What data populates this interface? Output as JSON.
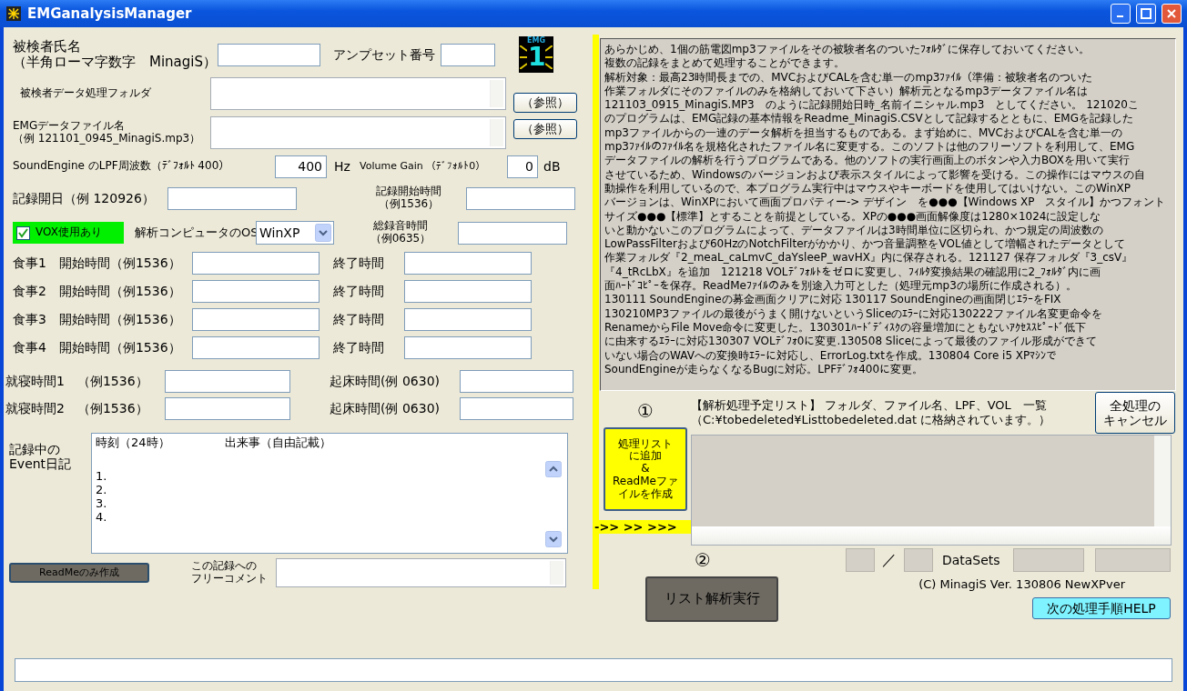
{
  "window": {
    "title": "EMGanalysisManager"
  },
  "logo": {
    "caption": "EMG",
    "digit": "1"
  },
  "subject_name": {
    "label": [
      "被検者氏名",
      "（半角ローマ字数字　MinagiS）"
    ]
  },
  "amp_set": {
    "label": "アンプセット番号"
  },
  "folder": {
    "label": "被検者データ処理フォルダ",
    "button": "（参照）"
  },
  "emg_file": {
    "label": [
      "EMGデータファイル名",
      "（例 121101_0945_MinagiS.mp3）"
    ],
    "button": "（参照）"
  },
  "lpf": {
    "label": "SoundEngine のLPF周波数（ﾃﾞﾌｫﾙﾄ 400）",
    "value": "400",
    "unit": "Hz"
  },
  "volume_gain": {
    "label": "Volume Gain （ﾃﾞﾌｫﾙﾄ0）",
    "value": "0",
    "unit": "dB"
  },
  "record_date": {
    "label": "記録開日（例 120926）"
  },
  "record_start": {
    "label": [
      "記録開始時間",
      "（例1536）"
    ]
  },
  "vox": {
    "label": "VOX使用あり",
    "checked": true
  },
  "os": {
    "label": "解析コンピュータのOS",
    "value": "WinXP"
  },
  "total_time": {
    "label": [
      "総録音時間",
      "（例0635）"
    ]
  },
  "meals": [
    {
      "label": "食事1　開始時間（例1536）",
      "end_label": "終了時間"
    },
    {
      "label": "食事2　開始時間（例1536）",
      "end_label": "終了時間"
    },
    {
      "label": "食事3　開始時間（例1536）",
      "end_label": "終了時間"
    },
    {
      "label": "食事4　開始時間（例1536）",
      "end_label": "終了時間"
    }
  ],
  "sleep": [
    {
      "label": "就寝時間1　（例1536）",
      "wake_label": "起床時間(例 0630)"
    },
    {
      "label": "就寝時間2　（例1536）",
      "wake_label": "起床時間(例 0630)"
    }
  ],
  "diary": {
    "label": [
      "記録中の",
      "Event日記"
    ],
    "header": [
      "時刻（24時）",
      "出来事（自由記載）"
    ],
    "lines": [
      "1.",
      "2.",
      "3.",
      "4."
    ]
  },
  "readme_button": "ReadMeのみ作成",
  "comment": {
    "label": [
      "この記録への",
      "フリーコメント"
    ]
  },
  "info_lines": [
    "あらかじめ、1個の筋電図mp3ファイルをその被験者名のついたﾌｫﾙﾀﾞに保存しておいてください。",
    "複数の記録をまとめて処理することができます。",
    "解析対象：最高23時間長までの、MVCおよびCALを含む単一のmp3ﾌｧｲﾙ（準備：被験者名のついた",
    "作業フォルダにそのファイルのみを格納しておいて下さい）解析元となるmp3データファイル名は",
    "121103_0915_MinagiS.MP3　のように記録開始日時_名前イニシャル.mp3　としてください。 121020こ",
    "のプログラムは、EMG記録の基本情報をReadme_MinagiS.CSVとして記録するとともに、EMGを記録した",
    "mp3ファイルからの一連のデータ解析を担当するものである。まず始めに、MVCおよびCALを含む単一の",
    "mp3ﾌｧｲﾙのﾌｧｲﾙ名を規格化されたファイル名に変更する。このソフトは他のフリーソフトを利用して、EMG",
    "データファイルの解析を行うプログラムである。他のソフトの実行画面上のボタンや入力BOXを用いて実行",
    "させているため、Windowsのバージョンおよび表示スタイルによって影響を受ける。この操作にはマウスの自",
    "動操作を利用しているので、本プログラム実行中はマウスやキーボードを使用してはいけない。このWinXP",
    "バージョンは、WinXPにおいて画面プロパティー-> デザイン　を●●●【Windows XP　スタイル】かつフォント",
    "サイズ●●●【標準】とすることを前提としている。XPの●●●画面解像度は1280×1024に設定しな",
    "いと動かないこのプログラムによって、データファイルは3時間単位に区切られ、かつ規定の周波数の",
    "LowPassFilterおよび60HzのNotchFilterがかかり、かつ音量調整をVOL値として増幅されたデータとして",
    "作業フォルダ『2_meaL_caLmvC_daYsleeP_wavHX』内に保存される。121127 保存フォルダ『3_csV』",
    "『4_tRcLbX』を追加　121218 VOLﾃﾞﾌｫﾙﾄをゼロに変更し、ﾌｨﾙﾀ変換結果の確認用に2_ﾌｫﾙﾀﾞ内に画",
    "面ﾊｰﾄﾞｺﾋﾟｰを保存。ReadMeﾌｧｲﾙのみを別途入力可とした（処理元mp3の場所に作成される）。",
    "130111 SoundEngineの募金画面クリアに対応 130117 SoundEngineの画面閉じｴﾗｰをFIX",
    "130210MP3ファイルの最後がうまく開けないというSliceのｴﾗｰに対応130222ファイル名変更命令を",
    "RenameからFile Move命令に変更した。130301ﾊｰﾄﾞﾃﾞｨｽｸの容量増加にともないｱｸｾｽｽﾋﾟｰﾄﾞ低下",
    "に由来するｴﾗｰに対応130307 VOLﾃﾞﾌｫ0に変更.130508 Sliceによって最後のファイル形成ができて",
    "いない場合のWAVへの変換時ｴﾗｰに対応し、ErrorLog.txtを作成。130804 Core i5 XPﾏｼﾝで",
    "SoundEngineが走らなくなるBugに対応。LPFﾃﾞﾌｫ400に変更。"
  ],
  "step1": "①",
  "add_button": [
    "処理リスト",
    "に追加",
    "&",
    "ReadMeファ",
    "イルを作成"
  ],
  "arrow": "->> >> >>>",
  "list": {
    "header": [
      "【解析処理予定リスト】 フォルダ、ファイル名、LPF、VOL　一覧",
      "（C:¥tobedeleted¥Listtobedeleted.dat に格納されています。）"
    ]
  },
  "cancel_button": [
    "全処理の",
    "キャンセル"
  ],
  "step2": "②",
  "counter": {
    "separator": "／",
    "label": "DataSets"
  },
  "copyright": "(C) MinagiS Ver. 130806 NewXPver",
  "run_button": "リスト解析実行",
  "help_button": "次の処理手順HELP"
}
